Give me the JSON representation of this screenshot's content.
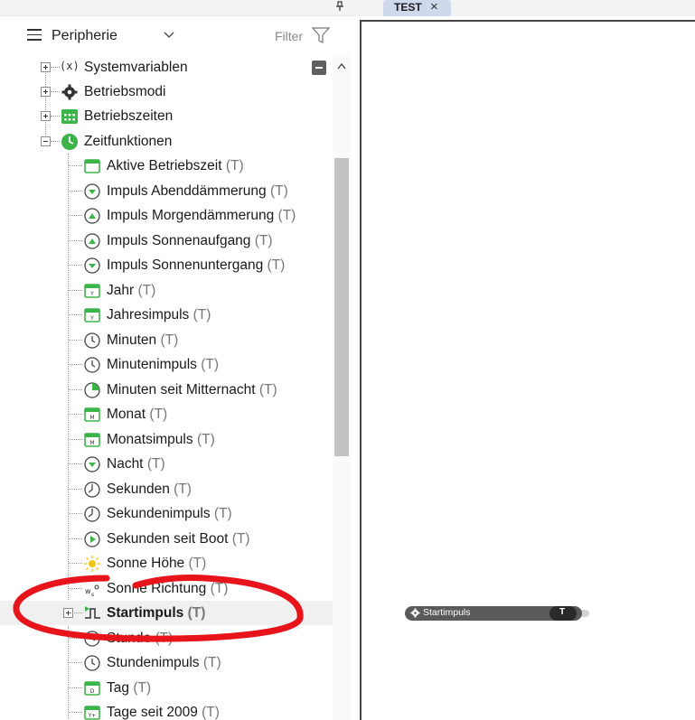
{
  "panel": {
    "title": "Peripherie",
    "filter_label": "Filter"
  },
  "tree": {
    "top_items": [
      {
        "label": "Systemvariablen",
        "icon": "variable-icon"
      },
      {
        "label": "Betriebsmodi",
        "icon": "gear-icon"
      },
      {
        "label": "Betriebszeiten",
        "icon": "calendar-grid-icon"
      },
      {
        "label": "Zeitfunktionen",
        "icon": "clock-green-icon"
      }
    ],
    "children": [
      {
        "label": "Aktive Betriebszeit",
        "tag": "(T)",
        "icon": "calendar-icon"
      },
      {
        "label": "Impuls Abenddämmerung",
        "tag": "(T)",
        "icon": "dusk-icon"
      },
      {
        "label": "Impuls Morgendämmerung",
        "tag": "(T)",
        "icon": "dawn-icon"
      },
      {
        "label": "Impuls Sonnenaufgang",
        "tag": "(T)",
        "icon": "sunrise-icon"
      },
      {
        "label": "Impuls Sonnenuntergang",
        "tag": "(T)",
        "icon": "sunset-icon"
      },
      {
        "label": "Jahr",
        "tag": "(T)",
        "icon": "calendar-year-icon"
      },
      {
        "label": "Jahresimpuls",
        "tag": "(T)",
        "icon": "calendar-year-icon"
      },
      {
        "label": "Minuten",
        "tag": "(T)",
        "icon": "clock-icon"
      },
      {
        "label": "Minutenimpuls",
        "tag": "(T)",
        "icon": "clock-icon"
      },
      {
        "label": "Minuten seit Mitternacht",
        "tag": "(T)",
        "icon": "clock-quarter-icon"
      },
      {
        "label": "Monat",
        "tag": "(T)",
        "icon": "calendar-month-icon"
      },
      {
        "label": "Monatsimpuls",
        "tag": "(T)",
        "icon": "calendar-month-icon"
      },
      {
        "label": "Nacht",
        "tag": "(T)",
        "icon": "night-icon"
      },
      {
        "label": "Sekunden",
        "tag": "(T)",
        "icon": "stopwatch-icon"
      },
      {
        "label": "Sekundenimpuls",
        "tag": "(T)",
        "icon": "stopwatch-icon"
      },
      {
        "label": "Sekunden seit Boot",
        "tag": "(T)",
        "icon": "play-clock-icon"
      },
      {
        "label": "Sonne Höhe",
        "tag": "(T)",
        "icon": "sun-icon"
      },
      {
        "label": "Sonne Richtung",
        "tag": "(T)",
        "icon": "compass-icon"
      },
      {
        "label": "Startimpuls",
        "tag": "(T)",
        "icon": "pulse-icon"
      },
      {
        "label": "Stunde",
        "tag": "(T)",
        "icon": "clock-icon"
      },
      {
        "label": "Stundenimpuls",
        "tag": "(T)",
        "icon": "clock-icon"
      },
      {
        "label": "Tag",
        "tag": "(T)",
        "icon": "calendar-day-icon"
      },
      {
        "label": "Tage seit 2009",
        "tag": "(T)",
        "icon": "calendar-days-icon"
      }
    ]
  },
  "editor": {
    "tab_label": "TEST",
    "node_label": "Startimpuls",
    "node_port": "T"
  },
  "colors": {
    "accent_green": "#3bb54a",
    "tab_bg": "#cfd9ec",
    "node_bg": "#5a5a5a",
    "annotation_red": "#e8141b"
  }
}
